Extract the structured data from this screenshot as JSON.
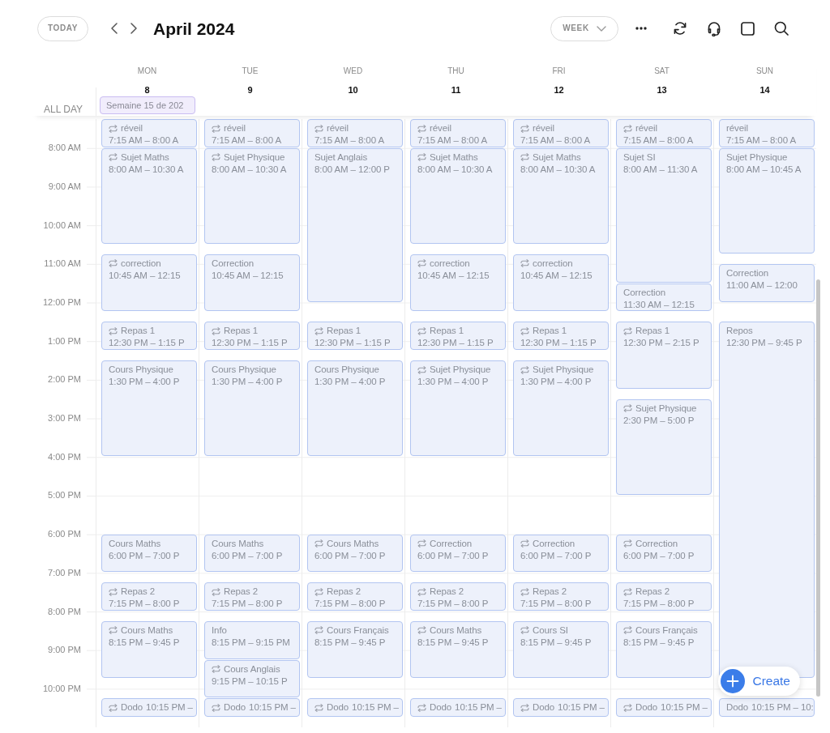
{
  "toolbar": {
    "today": "TODAY",
    "title": "April 2024",
    "view": "WEEK"
  },
  "all_day_label": "ALL DAY",
  "days": [
    {
      "weekday": "MON",
      "date": "8",
      "all_day_events": [
        "Semaine 15 de 202"
      ],
      "events": [
        {
          "title": "réveil",
          "time": "7:15 AM – 8:00 A",
          "repeat": true
        },
        {
          "title": "Sujet Maths",
          "time": "8:00 AM – 10:30 A",
          "repeat": true
        },
        {
          "title": "correction",
          "time": "10:45 AM – 12:15",
          "repeat": true
        },
        {
          "title": "Repas 1",
          "time": "12:30 PM – 1:15 P",
          "repeat": true
        },
        {
          "title": "Cours Physique",
          "time": "1:30 PM – 4:00 P",
          "repeat": false
        },
        {
          "title": "Cours Maths",
          "time": "6:00 PM – 7:00 P",
          "repeat": false
        },
        {
          "title": "Repas 2",
          "time": "7:15 PM – 8:00 P",
          "repeat": true
        },
        {
          "title": "Cours Maths",
          "time": "8:15 PM – 9:45 P",
          "repeat": true
        },
        {
          "title": "Dodo",
          "time": "10:15 PM –",
          "repeat": true
        }
      ]
    },
    {
      "weekday": "TUE",
      "date": "9",
      "events": [
        {
          "title": "réveil",
          "time": "7:15 AM – 8:00 A",
          "repeat": true
        },
        {
          "title": "Sujet Physique",
          "time": "8:00 AM – 10:30 A",
          "repeat": true
        },
        {
          "title": "Correction",
          "time": "10:45 AM – 12:15",
          "repeat": false
        },
        {
          "title": "Repas 1",
          "time": "12:30 PM – 1:15 P",
          "repeat": true
        },
        {
          "title": "Cours Physique",
          "time": "1:30 PM – 4:00 P",
          "repeat": false
        },
        {
          "title": "Cours Maths",
          "time": "6:00 PM – 7:00 P",
          "repeat": false
        },
        {
          "title": "Repas 2",
          "time": "7:15 PM – 8:00 P",
          "repeat": true
        },
        {
          "title": "Info",
          "time": "8:15 PM – 9:15 PM",
          "repeat": false
        },
        {
          "title": "Cours Anglais",
          "time": "9:15 PM – 10:15 P",
          "repeat": true
        },
        {
          "title": "Dodo",
          "time": "10:15 PM –",
          "repeat": true
        }
      ]
    },
    {
      "weekday": "WED",
      "date": "10",
      "events": [
        {
          "title": "réveil",
          "time": "7:15 AM – 8:00 A",
          "repeat": true
        },
        {
          "title": "Sujet Anglais",
          "time": "8:00 AM – 12:00 P",
          "repeat": false
        },
        {
          "title": "Repas 1",
          "time": "12:30 PM – 1:15 P",
          "repeat": true
        },
        {
          "title": "Cours Physique",
          "time": "1:30 PM – 4:00 P",
          "repeat": false
        },
        {
          "title": "Cours Maths",
          "time": "6:00 PM – 7:00 P",
          "repeat": true
        },
        {
          "title": "Repas 2",
          "time": "7:15 PM – 8:00 P",
          "repeat": true
        },
        {
          "title": "Cours Français",
          "time": "8:15 PM – 9:45 P",
          "repeat": true
        },
        {
          "title": "Dodo",
          "time": "10:15 PM –",
          "repeat": true
        }
      ]
    },
    {
      "weekday": "THU",
      "date": "11",
      "events": [
        {
          "title": "réveil",
          "time": "7:15 AM – 8:00 A",
          "repeat": true
        },
        {
          "title": "Sujet Maths",
          "time": "8:00 AM – 10:30 A",
          "repeat": true
        },
        {
          "title": "correction",
          "time": "10:45 AM – 12:15",
          "repeat": true
        },
        {
          "title": "Repas 1",
          "time": "12:30 PM – 1:15 P",
          "repeat": true
        },
        {
          "title": "Sujet Physique",
          "time": "1:30 PM – 4:00 P",
          "repeat": true
        },
        {
          "title": "Correction",
          "time": "6:00 PM – 7:00 P",
          "repeat": true
        },
        {
          "title": "Repas 2",
          "time": "7:15 PM – 8:00 P",
          "repeat": true
        },
        {
          "title": "Cours Maths",
          "time": "8:15 PM – 9:45 P",
          "repeat": true
        },
        {
          "title": "Dodo",
          "time": "10:15 PM –",
          "repeat": true
        }
      ]
    },
    {
      "weekday": "FRI",
      "date": "12",
      "events": [
        {
          "title": "réveil",
          "time": "7:15 AM – 8:00 A",
          "repeat": true
        },
        {
          "title": "Sujet Maths",
          "time": "8:00 AM – 10:30 A",
          "repeat": true
        },
        {
          "title": "correction",
          "time": "10:45 AM – 12:15",
          "repeat": true
        },
        {
          "title": "Repas 1",
          "time": "12:30 PM – 1:15 P",
          "repeat": true
        },
        {
          "title": "Sujet Physique",
          "time": "1:30 PM – 4:00 P",
          "repeat": true
        },
        {
          "title": "Correction",
          "time": "6:00 PM – 7:00 P",
          "repeat": true
        },
        {
          "title": "Repas 2",
          "time": "7:15 PM – 8:00 P",
          "repeat": true
        },
        {
          "title": "Cours SI",
          "time": "8:15 PM – 9:45 P",
          "repeat": true
        },
        {
          "title": "Dodo",
          "time": "10:15 PM –",
          "repeat": true
        }
      ]
    },
    {
      "weekday": "SAT",
      "date": "13",
      "events": [
        {
          "title": "réveil",
          "time": "7:15 AM – 8:00 A",
          "repeat": true
        },
        {
          "title": "Sujet SI",
          "time": "8:00 AM – 11:30 A",
          "repeat": false
        },
        {
          "title": "Correction",
          "time": "11:30 AM – 12:15",
          "repeat": false
        },
        {
          "title": "Repas 1",
          "time": "12:30 PM – 2:15 P",
          "repeat": true
        },
        {
          "title": "Sujet Physique",
          "time": "2:30 PM – 5:00 P",
          "repeat": true
        },
        {
          "title": "Correction",
          "time": "6:00 PM – 7:00 P",
          "repeat": true
        },
        {
          "title": "Repas 2",
          "time": "7:15 PM – 8:00 P",
          "repeat": true
        },
        {
          "title": "Cours Français",
          "time": "8:15 PM – 9:45 P",
          "repeat": true
        },
        {
          "title": "Dodo",
          "time": "10:15 PM –",
          "repeat": true
        }
      ]
    },
    {
      "weekday": "SUN",
      "date": "14",
      "events": [
        {
          "title": "réveil",
          "time": "7:15 AM – 8:00 A",
          "repeat": false
        },
        {
          "title": "Sujet Physique",
          "time": "8:00 AM – 10:45 A",
          "repeat": false
        },
        {
          "title": "Correction",
          "time": "11:00 AM – 12:00",
          "repeat": false
        },
        {
          "title": "Repos",
          "time": "12:30 PM – 9:45 P",
          "repeat": false
        },
        {
          "title": "Dodo",
          "time": "10:15 PM – 10:",
          "repeat": false
        }
      ]
    }
  ],
  "time_labels": [
    "8:00 AM",
    "9:00 AM",
    "10:00 AM",
    "11:00 AM",
    "12:00 PM",
    "1:00 PM",
    "2:00 PM",
    "3:00 PM",
    "4:00 PM",
    "5:00 PM",
    "6:00 PM",
    "7:00 PM",
    "8:00 PM",
    "9:00 PM",
    "10:00 PM"
  ],
  "create_button": "Create"
}
